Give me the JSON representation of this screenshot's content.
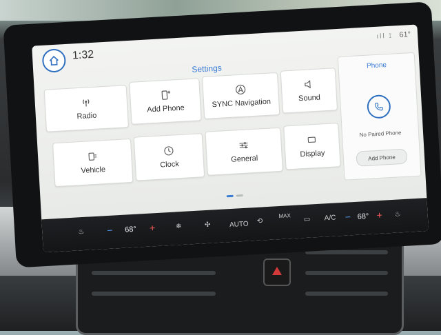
{
  "status": {
    "time": "1:32",
    "outside_temp": "61°",
    "signal": "ıll ⟟"
  },
  "settings": {
    "title": "Settings",
    "tiles": [
      {
        "label": "Radio",
        "icon": "radio-icon"
      },
      {
        "label": "Add Phone",
        "icon": "add-phone-icon"
      },
      {
        "label": "SYNC Navigation",
        "icon": "navigation-icon"
      },
      {
        "label": "Sound",
        "icon": "speaker-icon"
      },
      {
        "label": "Vehicle",
        "icon": "vehicle-icon"
      },
      {
        "label": "Clock",
        "icon": "clock-icon"
      },
      {
        "label": "General",
        "icon": "sliders-icon"
      },
      {
        "label": "Display",
        "icon": "display-icon"
      }
    ]
  },
  "phone": {
    "title": "Phone",
    "status": "No Paired Phone",
    "add_label": "Add Phone"
  },
  "climate": {
    "driver_temp": "68°",
    "passenger_temp": "68°",
    "auto_label": "AUTO",
    "max_label": "MAX",
    "ac_label": "A/C",
    "minus": "−",
    "plus": "+"
  },
  "colors": {
    "accent": "#3a7bd5",
    "bezel": "#111214",
    "screen_bg": "#f0f1ef"
  }
}
